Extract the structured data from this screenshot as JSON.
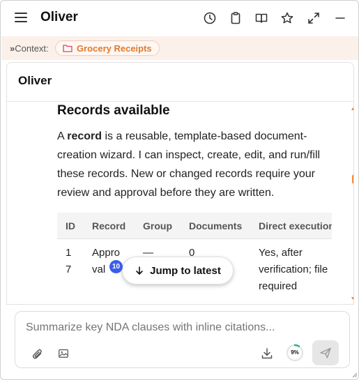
{
  "header": {
    "title": "Oliver",
    "icons": [
      "hamburger-icon",
      "history-icon",
      "clipboard-icon",
      "book-icon",
      "star-icon",
      "expand-icon",
      "minimize-icon"
    ]
  },
  "context": {
    "label": "Context:",
    "chip_label": "Grocery Receipts",
    "chip_icon": "folder-icon"
  },
  "panel": {
    "title": "Oliver",
    "section_heading": "Records available",
    "paragraph": {
      "pre": "A ",
      "bold": "record",
      "post": " is a reusable, template-based document-creation wizard. I can inspect, create, edit, and run/fill these records. New or changed records require your review and approval before they are written."
    },
    "table": {
      "columns": [
        "ID",
        "Record",
        "Group",
        "Documents",
        "Direct execution"
      ],
      "rows": [
        {
          "id": "1\n7",
          "record": "Appro\nval",
          "group": "—",
          "documents": "0",
          "direct_execution": "Yes, after verification; file required"
        }
      ]
    }
  },
  "jump": {
    "label": "Jump to latest",
    "badge": "10"
  },
  "composer": {
    "placeholder": "Summarize key NDA clauses with inline citations...",
    "progress": "9%",
    "progress_fraction": 0.09
  },
  "colors": {
    "accent": "#e87b2a",
    "badge": "#3b5ee9",
    "progress_ring": "#2ab37a"
  }
}
